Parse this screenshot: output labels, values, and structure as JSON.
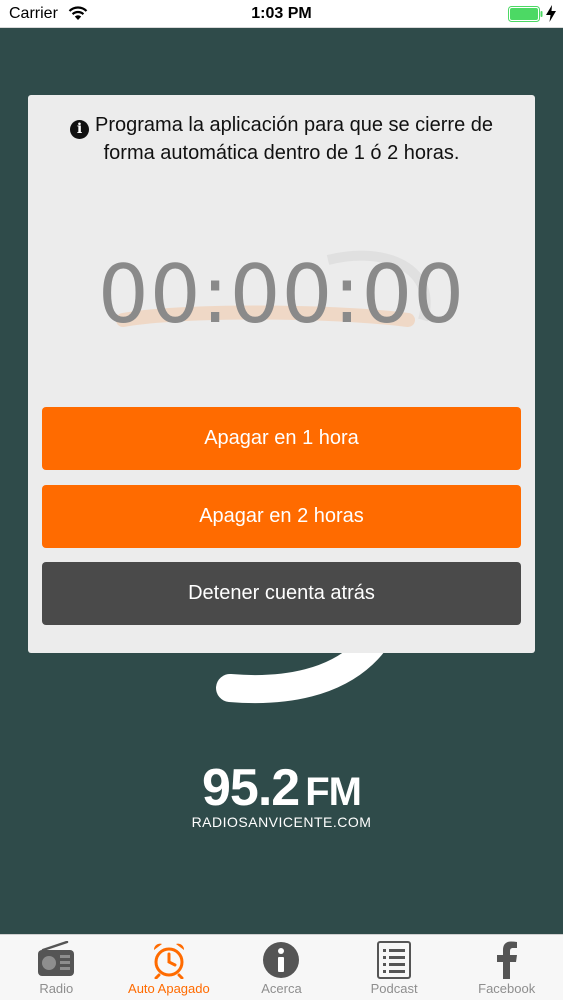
{
  "status_bar": {
    "carrier": "Carrier",
    "time": "1:03 PM"
  },
  "background": {
    "frequency": "95.2",
    "frequency_unit": "FM",
    "website": "RADIOSANVICENTE.COM"
  },
  "modal": {
    "info_text": "Programa la aplicación para que se cierre de forma automática dentro de 1 ó 2 horas.",
    "timer": "00:00:00",
    "buttons": [
      {
        "label": "Apagar en 1 hora"
      },
      {
        "label": "Apagar en 2 horas"
      },
      {
        "label": "Detener cuenta atrás"
      }
    ]
  },
  "tabs": [
    {
      "label": "Radio",
      "icon": "radio-icon",
      "active": false
    },
    {
      "label": "Auto Apagado",
      "icon": "alarm-clock-icon",
      "active": true
    },
    {
      "label": "Acerca",
      "icon": "info-icon",
      "active": false
    },
    {
      "label": "Podcast",
      "icon": "list-icon",
      "active": false
    },
    {
      "label": "Facebook",
      "icon": "facebook-icon",
      "active": false
    }
  ],
  "colors": {
    "accent": "#ff6b00",
    "background": "#2f4b4a",
    "dark_button": "#4a4a4a",
    "battery": "#4cd964"
  }
}
